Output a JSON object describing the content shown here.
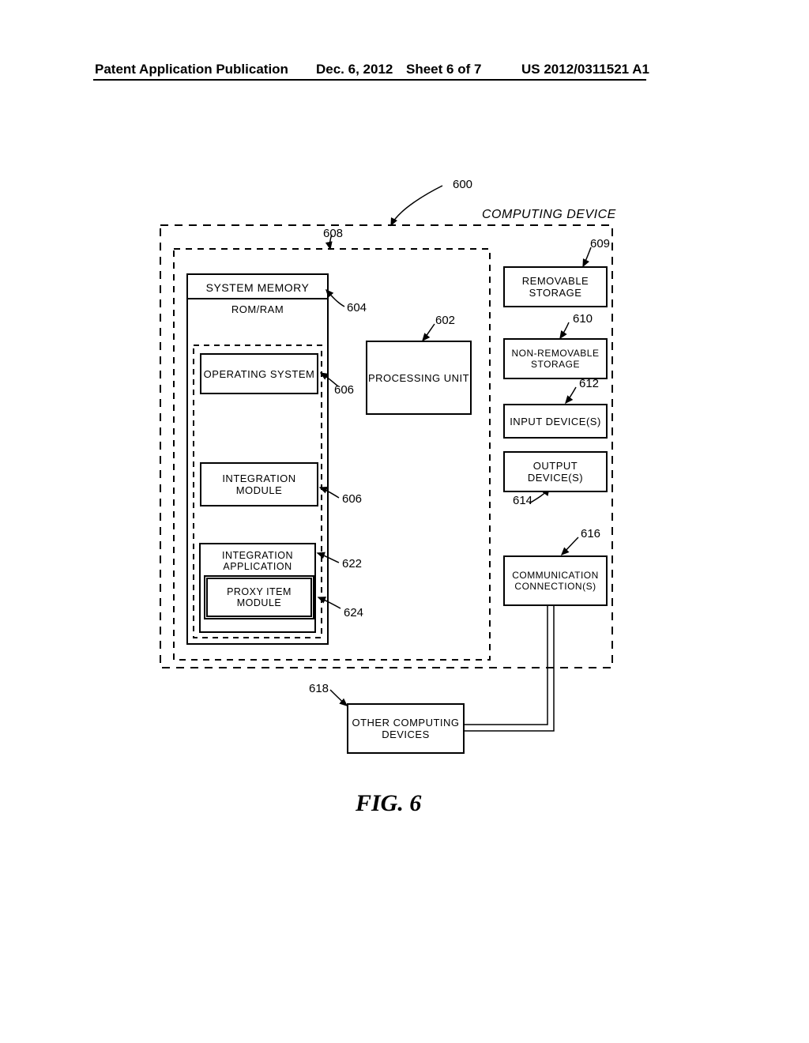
{
  "header": {
    "left": "Patent Application Publication",
    "date": "Dec. 6, 2012",
    "sheet": "Sheet 6 of 7",
    "pubno": "US 2012/0311521 A1"
  },
  "labels": {
    "computing_device": "COMPUTING DEVICE",
    "system_memory": "SYSTEM MEMORY",
    "rom_ram": "ROM/RAM",
    "operating_system": "OPERATING SYSTEM",
    "integration_module": "INTEGRATION MODULE",
    "integration_application": "INTEGRATION APPLICATION",
    "proxy_item_module": "PROXY ITEM MODULE",
    "processing_unit": "PROCESSING UNIT",
    "removable_storage": "REMOVABLE STORAGE",
    "non_removable_storage": "NON-REMOVABLE STORAGE",
    "input_devices": "INPUT DEVICE(S)",
    "output_devices": "OUTPUT DEVICE(S)",
    "communication_connections": "COMMUNICATION CONNECTION(S)",
    "other_computing_devices": "OTHER COMPUTING DEVICES"
  },
  "refs": {
    "r600": "600",
    "r602": "602",
    "r604": "604",
    "r606a": "606",
    "r606b": "606",
    "r608": "608",
    "r609": "609",
    "r610": "610",
    "r612": "612",
    "r614": "614",
    "r616": "616",
    "r618": "618",
    "r622": "622",
    "r624": "624"
  },
  "caption": "FIG. 6"
}
